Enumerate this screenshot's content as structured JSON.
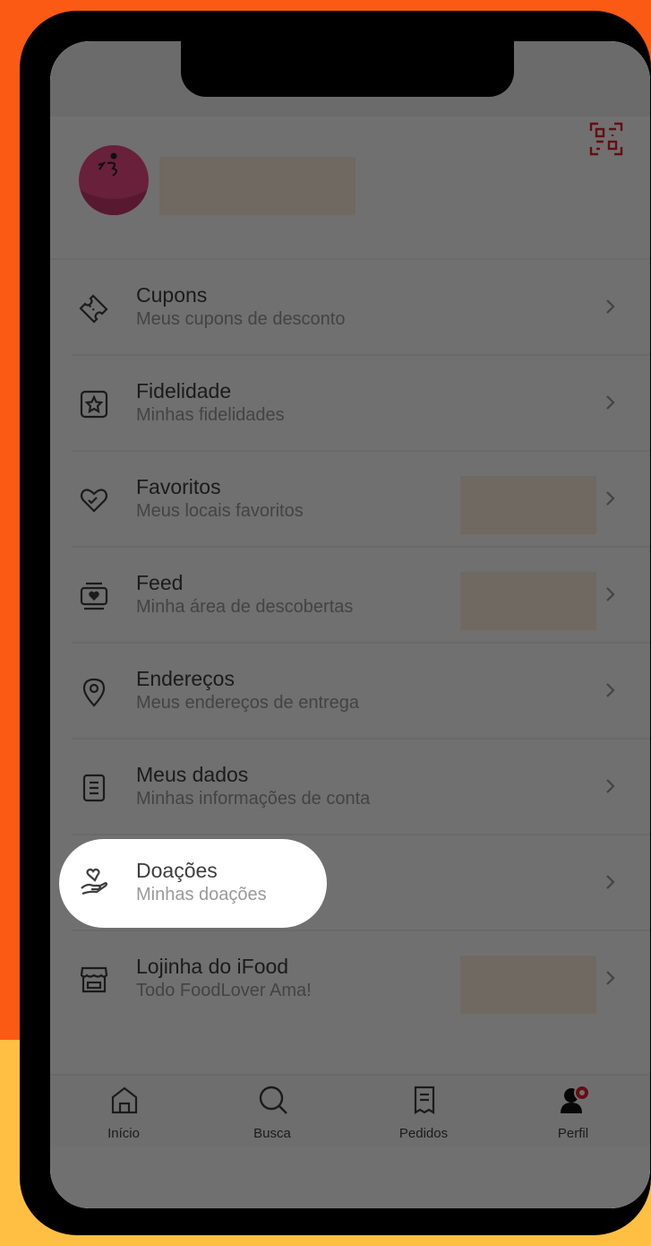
{
  "menu": [
    {
      "title": "Cupons",
      "subtitle": "Meus cupons de desconto",
      "icon": "ticket-icon"
    },
    {
      "title": "Fidelidade",
      "subtitle": "Minhas fidelidades",
      "icon": "star-badge-icon"
    },
    {
      "title": "Favoritos",
      "subtitle": "Meus locais favoritos",
      "icon": "heart-icon"
    },
    {
      "title": "Feed",
      "subtitle": "Minha área de descobertas",
      "icon": "feed-icon"
    },
    {
      "title": "Endereços",
      "subtitle": "Meus endereços de entrega",
      "icon": "location-pin-icon"
    },
    {
      "title": "Meus dados",
      "subtitle": "Minhas informações de conta",
      "icon": "document-icon"
    },
    {
      "title": "Doações",
      "subtitle": "Minhas doações",
      "icon": "heart-hand-icon"
    },
    {
      "title": "Lojinha do iFood",
      "subtitle": "Todo FoodLover Ama!",
      "icon": "store-icon"
    }
  ],
  "bottom_nav": {
    "inicio": "Início",
    "busca": "Busca",
    "pedidos": "Pedidos",
    "perfil": "Perfil"
  },
  "colors": {
    "brand_red": "#ea1d2c",
    "avatar_pink": "#f04a84",
    "background_orange": "#fa5a14",
    "background_yellow": "#ffbf42"
  }
}
